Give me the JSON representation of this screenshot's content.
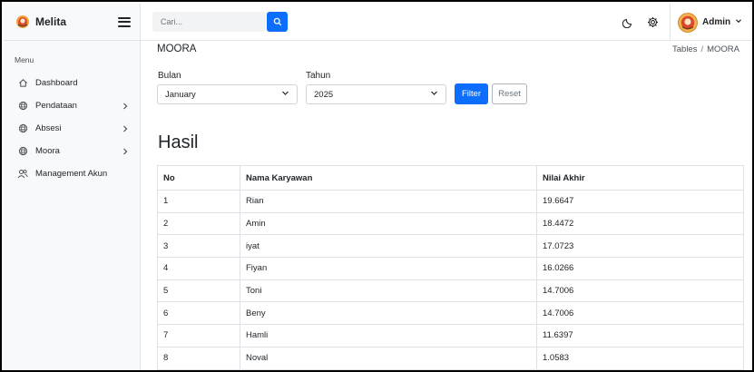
{
  "brand": {
    "name": "Melita",
    "logo_icon": "melita-logo-icon"
  },
  "sidebar": {
    "heading": "Menu",
    "items": [
      {
        "label": "Dashboard",
        "icon": "home-icon",
        "has_submenu": false
      },
      {
        "label": "Pendataan",
        "icon": "globe-icon",
        "has_submenu": true
      },
      {
        "label": "Absesi",
        "icon": "globe-icon",
        "has_submenu": true
      },
      {
        "label": "Moora",
        "icon": "globe-icon",
        "has_submenu": true
      },
      {
        "label": "Management Akun",
        "icon": "users-icon",
        "has_submenu": false
      }
    ]
  },
  "topbar": {
    "search_placeholder": "Cari...",
    "user_name": "Admin"
  },
  "page": {
    "title": "MOORA",
    "breadcrumb": [
      "Tables",
      "MOORA"
    ]
  },
  "filters": {
    "bulan_label": "Bulan",
    "bulan_value": "January",
    "tahun_label": "Tahun",
    "tahun_value": "2025",
    "filter_label": "Filter",
    "reset_label": "Reset"
  },
  "results": {
    "title": "Hasil",
    "columns": [
      "No",
      "Nama Karyawan",
      "Nilai Akhir"
    ],
    "rows": [
      [
        "1",
        "Rian",
        "19.6647"
      ],
      [
        "2",
        "Amin",
        "18.4472"
      ],
      [
        "3",
        "iyat",
        "17.0723"
      ],
      [
        "4",
        "Fiyan",
        "16.0266"
      ],
      [
        "5",
        "Toni",
        "14.7006"
      ],
      [
        "6",
        "Beny",
        "14.7006"
      ],
      [
        "7",
        "Hamli",
        "11.6397"
      ],
      [
        "8",
        "Noval",
        "1.0583"
      ]
    ]
  },
  "colors": {
    "primary": "#0d6efd",
    "sidebar_bg": "#f8f9fa",
    "border": "#dee2e6"
  }
}
